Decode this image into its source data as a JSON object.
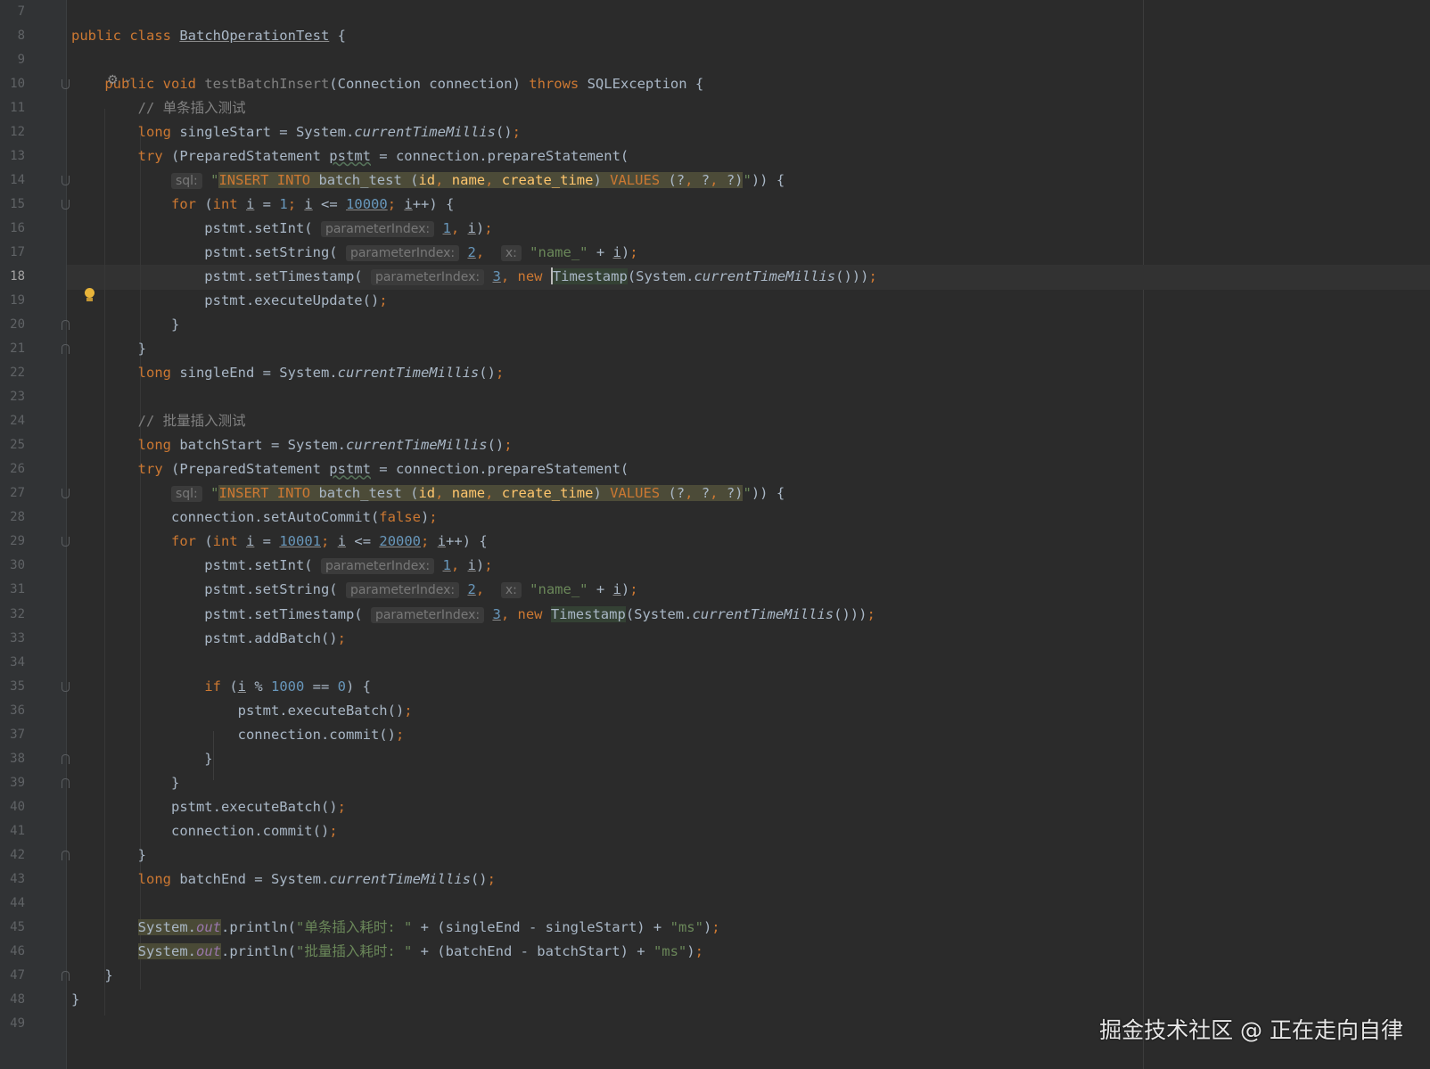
{
  "watermark": "掘金技术社区 @ 正在走向自律",
  "current_line": 18,
  "icons": {
    "run": "run-gutter-icon",
    "bulb": "intention-bulb-icon"
  },
  "lines": [
    {
      "n": "7",
      "tokens": []
    },
    {
      "n": "8",
      "tokens": [
        {
          "t": "public class ",
          "c": "kw"
        },
        {
          "t": "BatchOperationTest",
          "c": "ul"
        },
        {
          "t": " {"
        }
      ]
    },
    {
      "n": "9",
      "tokens": []
    },
    {
      "n": "10",
      "tokens": [
        {
          "t": "    public void ",
          "c": "kw"
        },
        {
          "t": "testBatchInsert",
          "c": "unused"
        },
        {
          "t": "(Connection connection) "
        },
        {
          "t": "throws",
          "c": "kw"
        },
        {
          "t": " SQLException {"
        }
      ]
    },
    {
      "n": "11",
      "tokens": [
        {
          "t": "        // 单条插入测试",
          "c": "cmt"
        }
      ]
    },
    {
      "n": "12",
      "tokens": [
        {
          "t": "        "
        },
        {
          "t": "long",
          "c": "kw"
        },
        {
          "t": " singleStart = System."
        },
        {
          "t": "currentTimeMillis",
          "c": "ital"
        },
        {
          "t": "()"
        },
        {
          "t": ";",
          "c": "kw"
        }
      ]
    },
    {
      "n": "13",
      "tokens": [
        {
          "t": "        "
        },
        {
          "t": "try",
          "c": "kw"
        },
        {
          "t": " (PreparedStatement "
        },
        {
          "t": "pstmt",
          "c": "sq"
        },
        {
          "t": " = connection.prepareStatement("
        }
      ]
    },
    {
      "n": "14",
      "tokens": [
        {
          "t": "            "
        },
        {
          "t": "sql:",
          "c": "hint"
        },
        {
          "t": " "
        },
        {
          "t": "\"",
          "c": "str"
        },
        {
          "t": "INSERT INTO",
          "c": "sql-kw inj"
        },
        {
          "t": " batch_test (",
          "c": "inj"
        },
        {
          "t": "id",
          "c": "sql-id inj"
        },
        {
          "t": ", ",
          "c": "sql-kw inj"
        },
        {
          "t": "name",
          "c": "sql-id inj"
        },
        {
          "t": ", ",
          "c": "sql-kw inj"
        },
        {
          "t": "create_time",
          "c": "sql-id inj"
        },
        {
          "t": ") ",
          "c": "inj"
        },
        {
          "t": "VALUES",
          "c": "sql-kw inj"
        },
        {
          "t": " (?",
          "c": "inj"
        },
        {
          "t": ", ",
          "c": "sql-kw inj"
        },
        {
          "t": "?",
          "c": "inj"
        },
        {
          "t": ", ",
          "c": "sql-kw inj"
        },
        {
          "t": "?)",
          "c": "inj"
        },
        {
          "t": "\"",
          "c": "str"
        },
        {
          "t": ")) {"
        }
      ]
    },
    {
      "n": "15",
      "tokens": [
        {
          "t": "            "
        },
        {
          "t": "for",
          "c": "kw"
        },
        {
          "t": " ("
        },
        {
          "t": "int",
          "c": "kw"
        },
        {
          "t": " "
        },
        {
          "t": "i",
          "c": "ul"
        },
        {
          "t": " = "
        },
        {
          "t": "1",
          "c": "num"
        },
        {
          "t": "; ",
          "c": "kw"
        },
        {
          "t": "i",
          "c": "ul"
        },
        {
          "t": " <= "
        },
        {
          "t": "10000",
          "c": "num ul"
        },
        {
          "t": "; ",
          "c": "kw"
        },
        {
          "t": "i",
          "c": "ul"
        },
        {
          "t": "++) {"
        }
      ]
    },
    {
      "n": "16",
      "tokens": [
        {
          "t": "                pstmt.setInt( "
        },
        {
          "t": "parameterIndex:",
          "c": "hint"
        },
        {
          "t": " "
        },
        {
          "t": "1",
          "c": "num ul"
        },
        {
          "t": ", ",
          "c": "kw"
        },
        {
          "t": "i",
          "c": "ul"
        },
        {
          "t": ")"
        },
        {
          "t": ";",
          "c": "kw"
        }
      ]
    },
    {
      "n": "17",
      "tokens": [
        {
          "t": "                pstmt.setString( "
        },
        {
          "t": "parameterIndex:",
          "c": "hint"
        },
        {
          "t": " "
        },
        {
          "t": "2",
          "c": "num ul"
        },
        {
          "t": ",  ",
          "c": "kw"
        },
        {
          "t": "x:",
          "c": "hint"
        },
        {
          "t": " "
        },
        {
          "t": "\"name_\"",
          "c": "str"
        },
        {
          "t": " + "
        },
        {
          "t": "i",
          "c": "ul"
        },
        {
          "t": ")"
        },
        {
          "t": ";",
          "c": "kw"
        }
      ]
    },
    {
      "n": "18",
      "tokens": [
        {
          "t": "                pstmt.setTimestamp( "
        },
        {
          "t": "parameterIndex:",
          "c": "hint"
        },
        {
          "t": " "
        },
        {
          "t": "3",
          "c": "num ul"
        },
        {
          "t": ", ",
          "c": "kw"
        },
        {
          "t": "new ",
          "c": "kw"
        },
        {
          "caret": true
        },
        {
          "t": "Timestamp",
          "c": "tsbg"
        },
        {
          "t": "(System."
        },
        {
          "t": "currentTimeMillis",
          "c": "ital"
        },
        {
          "t": "()))"
        },
        {
          "t": ";",
          "c": "kw"
        }
      ]
    },
    {
      "n": "19",
      "tokens": [
        {
          "t": "                pstmt.executeUpdate()"
        },
        {
          "t": ";",
          "c": "kw"
        }
      ]
    },
    {
      "n": "20",
      "tokens": [
        {
          "t": "            }"
        }
      ]
    },
    {
      "n": "21",
      "tokens": [
        {
          "t": "        }"
        }
      ]
    },
    {
      "n": "22",
      "tokens": [
        {
          "t": "        "
        },
        {
          "t": "long",
          "c": "kw"
        },
        {
          "t": " singleEnd = System."
        },
        {
          "t": "currentTimeMillis",
          "c": "ital"
        },
        {
          "t": "()"
        },
        {
          "t": ";",
          "c": "kw"
        }
      ]
    },
    {
      "n": "23",
      "tokens": []
    },
    {
      "n": "24",
      "tokens": [
        {
          "t": "        // 批量插入测试",
          "c": "cmt"
        }
      ]
    },
    {
      "n": "25",
      "tokens": [
        {
          "t": "        "
        },
        {
          "t": "long",
          "c": "kw"
        },
        {
          "t": " batchStart = System."
        },
        {
          "t": "currentTimeMillis",
          "c": "ital"
        },
        {
          "t": "()"
        },
        {
          "t": ";",
          "c": "kw"
        }
      ]
    },
    {
      "n": "26",
      "tokens": [
        {
          "t": "        "
        },
        {
          "t": "try",
          "c": "kw"
        },
        {
          "t": " (PreparedStatement "
        },
        {
          "t": "pstmt",
          "c": "sq"
        },
        {
          "t": " = connection.prepareStatement("
        }
      ]
    },
    {
      "n": "27",
      "tokens": [
        {
          "t": "            "
        },
        {
          "t": "sql:",
          "c": "hint"
        },
        {
          "t": " "
        },
        {
          "t": "\"",
          "c": "str"
        },
        {
          "t": "INSERT INTO",
          "c": "sql-kw inj"
        },
        {
          "t": " batch_test (",
          "c": "inj"
        },
        {
          "t": "id",
          "c": "sql-id inj"
        },
        {
          "t": ", ",
          "c": "sql-kw inj"
        },
        {
          "t": "name",
          "c": "sql-id inj"
        },
        {
          "t": ", ",
          "c": "sql-kw inj"
        },
        {
          "t": "create_time",
          "c": "sql-id inj"
        },
        {
          "t": ") ",
          "c": "inj"
        },
        {
          "t": "VALUES",
          "c": "sql-kw inj"
        },
        {
          "t": " (?",
          "c": "inj"
        },
        {
          "t": ", ",
          "c": "sql-kw inj"
        },
        {
          "t": "?",
          "c": "inj"
        },
        {
          "t": ", ",
          "c": "sql-kw inj"
        },
        {
          "t": "?)",
          "c": "inj"
        },
        {
          "t": "\"",
          "c": "str"
        },
        {
          "t": ")) {"
        }
      ]
    },
    {
      "n": "28",
      "tokens": [
        {
          "t": "            connection.setAutoCommit("
        },
        {
          "t": "false",
          "c": "kw"
        },
        {
          "t": ")"
        },
        {
          "t": ";",
          "c": "kw"
        }
      ]
    },
    {
      "n": "29",
      "tokens": [
        {
          "t": "            "
        },
        {
          "t": "for",
          "c": "kw"
        },
        {
          "t": " ("
        },
        {
          "t": "int",
          "c": "kw"
        },
        {
          "t": " "
        },
        {
          "t": "i",
          "c": "ul"
        },
        {
          "t": " = "
        },
        {
          "t": "10001",
          "c": "num ul"
        },
        {
          "t": "; ",
          "c": "kw"
        },
        {
          "t": "i",
          "c": "ul"
        },
        {
          "t": " <= "
        },
        {
          "t": "20000",
          "c": "num ul"
        },
        {
          "t": "; ",
          "c": "kw"
        },
        {
          "t": "i",
          "c": "ul"
        },
        {
          "t": "++) {"
        }
      ]
    },
    {
      "n": "30",
      "tokens": [
        {
          "t": "                pstmt.setInt( "
        },
        {
          "t": "parameterIndex:",
          "c": "hint"
        },
        {
          "t": " "
        },
        {
          "t": "1",
          "c": "num ul"
        },
        {
          "t": ", ",
          "c": "kw"
        },
        {
          "t": "i",
          "c": "ul"
        },
        {
          "t": ")"
        },
        {
          "t": ";",
          "c": "kw"
        }
      ]
    },
    {
      "n": "31",
      "tokens": [
        {
          "t": "                pstmt.setString( "
        },
        {
          "t": "parameterIndex:",
          "c": "hint"
        },
        {
          "t": " "
        },
        {
          "t": "2",
          "c": "num ul"
        },
        {
          "t": ",  ",
          "c": "kw"
        },
        {
          "t": "x:",
          "c": "hint"
        },
        {
          "t": " "
        },
        {
          "t": "\"name_\"",
          "c": "str"
        },
        {
          "t": " + "
        },
        {
          "t": "i",
          "c": "ul"
        },
        {
          "t": ")"
        },
        {
          "t": ";",
          "c": "kw"
        }
      ]
    },
    {
      "n": "32",
      "tokens": [
        {
          "t": "                pstmt.setTimestamp( "
        },
        {
          "t": "parameterIndex:",
          "c": "hint"
        },
        {
          "t": " "
        },
        {
          "t": "3",
          "c": "num ul"
        },
        {
          "t": ", ",
          "c": "kw"
        },
        {
          "t": "new ",
          "c": "kw"
        },
        {
          "t": "Timestamp",
          "c": "tsbg"
        },
        {
          "t": "(System."
        },
        {
          "t": "currentTimeMillis",
          "c": "ital"
        },
        {
          "t": "()))"
        },
        {
          "t": ";",
          "c": "kw"
        }
      ]
    },
    {
      "n": "33",
      "tokens": [
        {
          "t": "                pstmt.addBatch()"
        },
        {
          "t": ";",
          "c": "kw"
        }
      ]
    },
    {
      "n": "34",
      "tokens": []
    },
    {
      "n": "35",
      "tokens": [
        {
          "t": "                "
        },
        {
          "t": "if",
          "c": "kw"
        },
        {
          "t": " ("
        },
        {
          "t": "i",
          "c": "ul"
        },
        {
          "t": " % "
        },
        {
          "t": "1000",
          "c": "num"
        },
        {
          "t": " == "
        },
        {
          "t": "0",
          "c": "num"
        },
        {
          "t": ") {"
        }
      ]
    },
    {
      "n": "36",
      "tokens": [
        {
          "t": "                    pstmt.executeBatch()"
        },
        {
          "t": ";",
          "c": "kw"
        }
      ]
    },
    {
      "n": "37",
      "tokens": [
        {
          "t": "                    connection.commit()"
        },
        {
          "t": ";",
          "c": "kw"
        }
      ]
    },
    {
      "n": "38",
      "tokens": [
        {
          "t": "                }"
        }
      ]
    },
    {
      "n": "39",
      "tokens": [
        {
          "t": "            }"
        }
      ]
    },
    {
      "n": "40",
      "tokens": [
        {
          "t": "            pstmt.executeBatch()"
        },
        {
          "t": ";",
          "c": "kw"
        }
      ]
    },
    {
      "n": "41",
      "tokens": [
        {
          "t": "            connection.commit()"
        },
        {
          "t": ";",
          "c": "kw"
        }
      ]
    },
    {
      "n": "42",
      "tokens": [
        {
          "t": "        }"
        }
      ]
    },
    {
      "n": "43",
      "tokens": [
        {
          "t": "        "
        },
        {
          "t": "long",
          "c": "kw"
        },
        {
          "t": " batchEnd = System."
        },
        {
          "t": "currentTimeMillis",
          "c": "ital"
        },
        {
          "t": "()"
        },
        {
          "t": ";",
          "c": "kw"
        }
      ]
    },
    {
      "n": "44",
      "tokens": []
    },
    {
      "n": "45",
      "tokens": [
        {
          "t": "        "
        },
        {
          "t": "System.",
          "c": "sysbg"
        },
        {
          "t": "out",
          "c": "fld sysbg"
        },
        {
          "t": ".println("
        },
        {
          "t": "\"单条插入耗时: \"",
          "c": "str"
        },
        {
          "t": " + (singleEnd - singleStart) + "
        },
        {
          "t": "\"ms\"",
          "c": "str"
        },
        {
          "t": ")"
        },
        {
          "t": ";",
          "c": "kw"
        }
      ]
    },
    {
      "n": "46",
      "tokens": [
        {
          "t": "        "
        },
        {
          "t": "System.",
          "c": "sysbg"
        },
        {
          "t": "out",
          "c": "fld sysbg"
        },
        {
          "t": ".println("
        },
        {
          "t": "\"批量插入耗时: \"",
          "c": "str"
        },
        {
          "t": " + (batchEnd - batchStart) + "
        },
        {
          "t": "\"ms\"",
          "c": "str"
        },
        {
          "t": ")"
        },
        {
          "t": ";",
          "c": "kw"
        }
      ]
    },
    {
      "n": "47",
      "tokens": [
        {
          "t": "    }"
        }
      ]
    },
    {
      "n": "48",
      "tokens": [
        {
          "t": "}"
        }
      ]
    },
    {
      "n": "49",
      "tokens": []
    }
  ]
}
